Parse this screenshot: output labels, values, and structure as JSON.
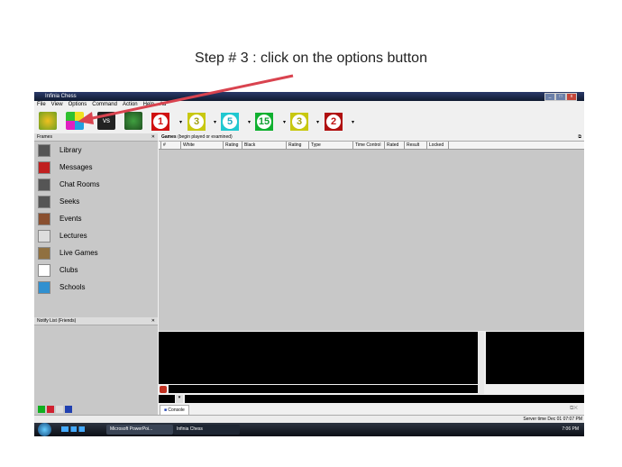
{
  "slide": {
    "title": "Step # 3 : click on the options button",
    "arrow_color": "#d9434f"
  },
  "window": {
    "title": "Infinia Chess",
    "menu": [
      "File",
      "View",
      "Options",
      "Command",
      "Action",
      "Help",
      "Ad"
    ],
    "toolbar": {
      "buttons": [
        "login-icon",
        "options-icon",
        "vs-icon",
        "binoculars-icon"
      ],
      "clocks": [
        {
          "label": "1",
          "color": "#d01010"
        },
        {
          "label": "3",
          "color": "#c8c810"
        },
        {
          "label": "5",
          "color": "#20c8d0"
        },
        {
          "label": "15",
          "color": "#10b030"
        },
        {
          "label": "3",
          "color": "#c8c810"
        },
        {
          "label": "2",
          "color": "#b01010"
        }
      ]
    }
  },
  "frames": {
    "title": "Frames",
    "items": [
      "Library",
      "Messages",
      "Chat Rooms",
      "Seeks",
      "Events",
      "Lectures",
      "Live Games",
      "Clubs",
      "Schools"
    ]
  },
  "notify": {
    "title": "Notify List (Friends)"
  },
  "games": {
    "title": "Games",
    "subtitle": "(begin played or examined)",
    "columns": [
      "#",
      "White",
      "Rating",
      "Black",
      "Rating",
      "Type",
      "Time Control",
      "Rated",
      "Result",
      "Locked"
    ]
  },
  "console": {
    "tab": "Console"
  },
  "status": {
    "server_time": "Server time Dec 01 07:07 PM"
  },
  "taskbar": {
    "tasks": [
      "Microsoft PowerPoi...",
      "Infinia Chess"
    ],
    "clock": "7:06 PM"
  }
}
